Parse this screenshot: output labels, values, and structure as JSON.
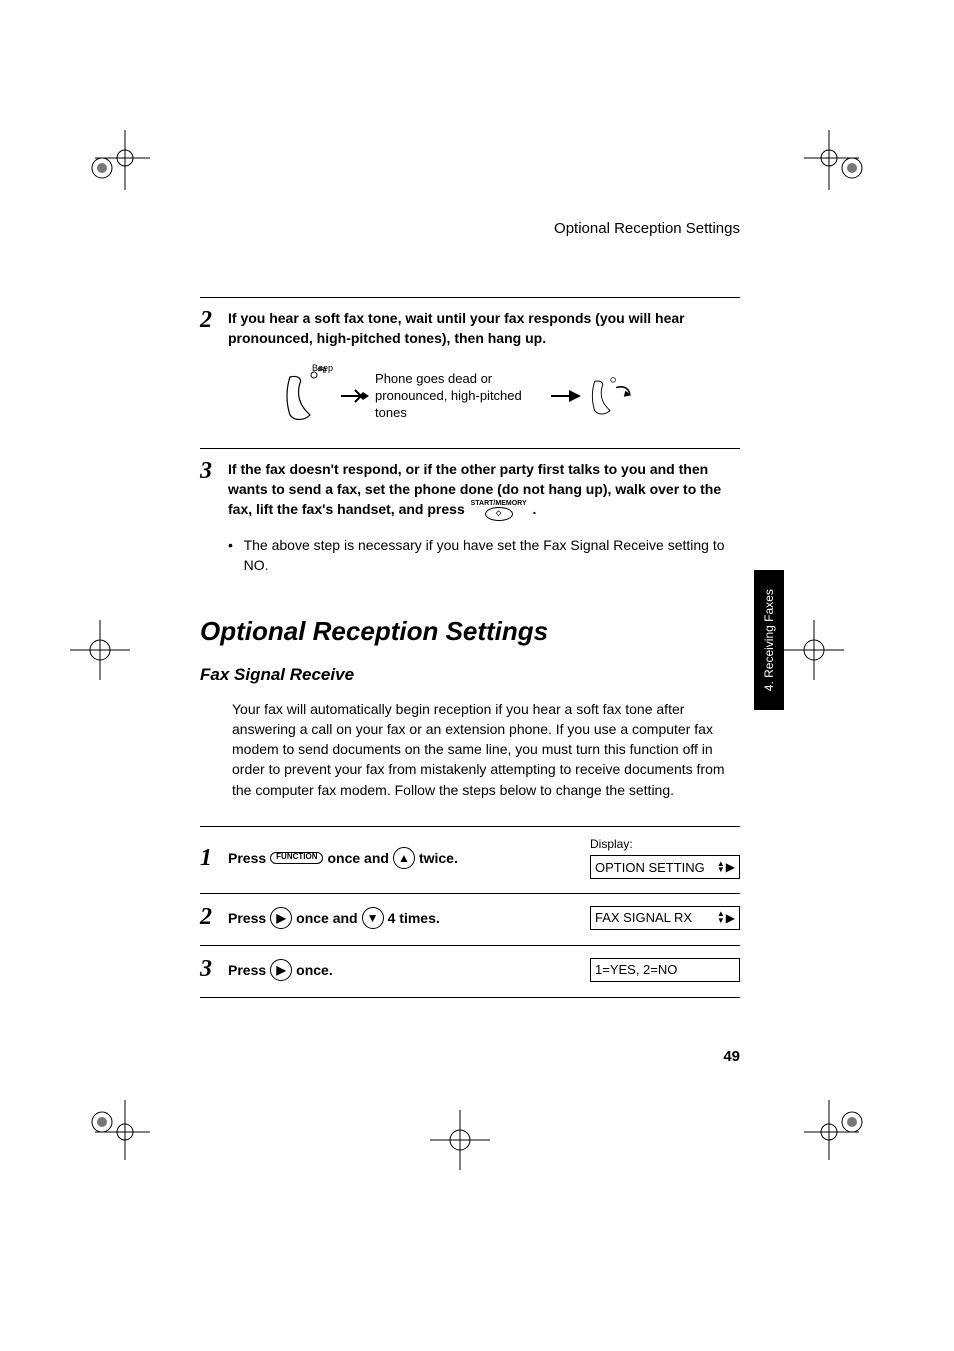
{
  "header": {
    "title": "Optional Reception Settings"
  },
  "sideTab": {
    "label": "4. Receiving\nFaxes"
  },
  "sectionA": {
    "step2": {
      "num": "2",
      "text": "If you hear a soft fax tone, wait until your fax responds (you will hear pronounced, high-pitched tones), then hang up.",
      "beep": "Beep",
      "diagText": "Phone goes dead or pronounced, high-pitched tones"
    },
    "step3": {
      "num": "3",
      "textA": "If the fax doesn't respond, or if the other party first talks to you and then wants to send a fax, set the phone done (do not hang up), walk over to the fax, lift the fax's handset, and press",
      "btnLabel": "START/MEMORY",
      "textB": ".",
      "bullet": "The above step is necessary if you have set the Fax Signal Receive setting to NO."
    }
  },
  "sectionB": {
    "heading": "Optional Reception Settings",
    "subheading": "Fax Signal Receive",
    "para": "Your fax will automatically begin reception if you hear a soft fax tone after answering a call on your fax or an extension phone. If you use a computer fax modem to send documents on the same line, you must turn this function off in order to prevent your fax from mistakenly attempting to receive documents from the computer fax modem. Follow the steps below to change the setting."
  },
  "procedure": {
    "displayLabel": "Display:",
    "steps": [
      {
        "num": "1",
        "parts": [
          "Press",
          "FUNCTION",
          "once and",
          "UP",
          "twice."
        ],
        "lcd": "OPTION SETTING",
        "arrows": "▲▼▶"
      },
      {
        "num": "2",
        "parts": [
          "Press",
          "RIGHT",
          "once and",
          "DOWN",
          "4 times."
        ],
        "lcd": "FAX SIGNAL RX",
        "arrows": "▲▼▶"
      },
      {
        "num": "3",
        "parts": [
          "Press",
          "RIGHT",
          "once."
        ],
        "lcd": "1=YES, 2=NO",
        "arrows": ""
      }
    ]
  },
  "pageNumber": "49"
}
